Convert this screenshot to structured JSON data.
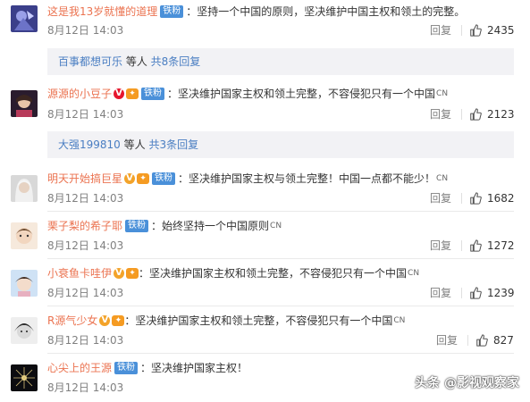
{
  "comments": [
    {
      "name": "这是我13岁就懂的道理",
      "tag": "铁粉",
      "text": "：坚持一个中国的原则，坚决维护中国主权和领土的完整。",
      "time": "8月12日 14:03",
      "reply": "回复",
      "likes": "2435"
    },
    {
      "name": "源源的小豆子",
      "tag": "铁粉",
      "text": "：坚决维护国家主权和领土完整，不容侵犯只有一个中国",
      "cn": "CN",
      "time": "8月12日 14:03",
      "reply": "回复",
      "likes": "2123"
    },
    {
      "name": "明天开始搞巨星",
      "tag": "铁粉",
      "text": "：坚决维护国家主权与领土完整！中国一点都不能少！",
      "cn": "CN",
      "time": "8月12日 14:03",
      "reply": "回复",
      "likes": "1682"
    },
    {
      "name": "栗子梨的希子耶",
      "tag": "铁粉",
      "text": "：始终坚持一个中国原则",
      "cn": "CN",
      "time": "8月12日 14:03",
      "reply": "回复",
      "likes": "1272"
    },
    {
      "name": "小衰鱼卡哇伊",
      "text": "：坚决维护国家主权和领土完整，不容侵犯只有一个中国",
      "cn": "CN",
      "time": "8月12日 14:03",
      "reply": "回复",
      "likes": "1239"
    },
    {
      "name": "R源气少女",
      "text": "：坚决维护国家主权和领土完整，不容侵犯只有一个中国",
      "cn": "CN",
      "time": "8月12日 14:03",
      "reply": "回复",
      "likes": "827"
    },
    {
      "name": "心尖上的王源",
      "tag": "铁粉",
      "text": "：坚决维护国家主权！",
      "time": "8月12日 14:03"
    }
  ],
  "subreplies": [
    {
      "name": "百事都想可乐",
      "mid": " 等人 ",
      "more": "共8条回复"
    },
    {
      "name": "大强199810",
      "mid": " 等人 ",
      "more": "共3条回复"
    }
  ],
  "watermark": "头条 @影视观察家",
  "icons": {
    "like": "thumbs-up-icon",
    "verified": "verified-v-icon",
    "medal": "medal-icon"
  },
  "colors": {
    "username": "#eb7350",
    "subname": "#4a7ec2",
    "tag": "#4a90d9",
    "subbox": "#f2f2f5"
  }
}
